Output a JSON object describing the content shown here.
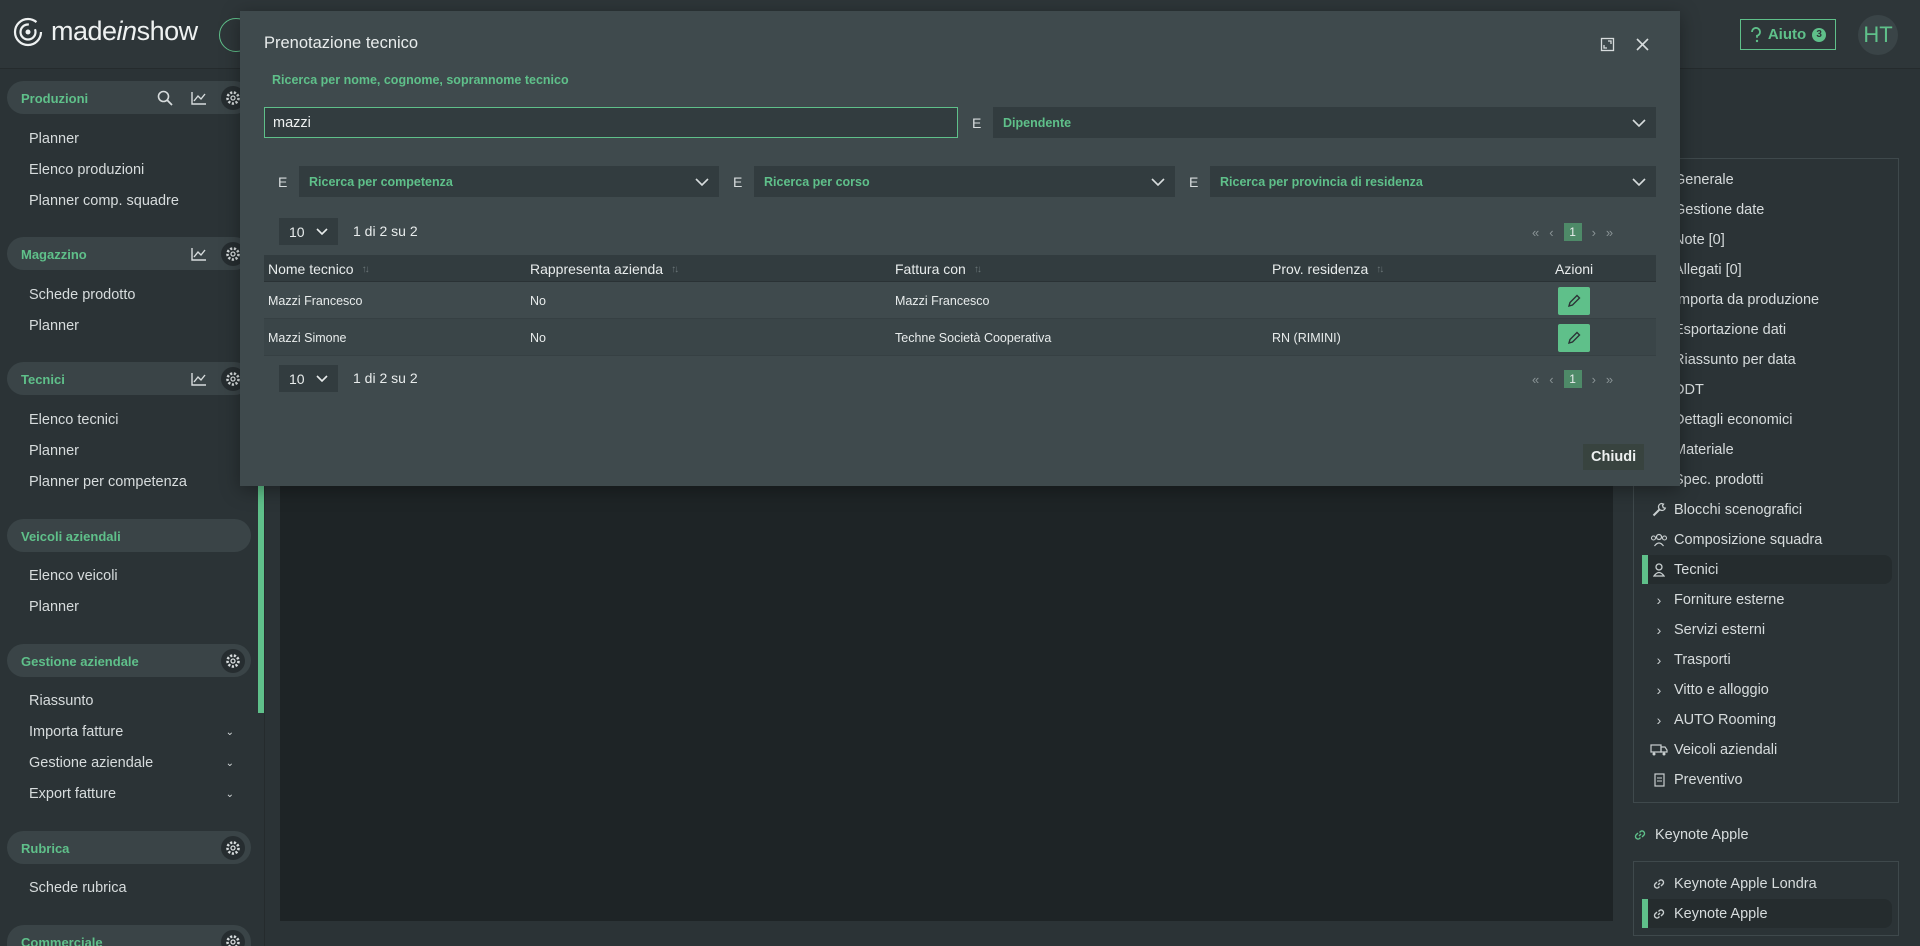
{
  "topbar": {
    "logo_text": "madeinshow",
    "help_label": "Aiuto",
    "help_badge": "3",
    "avatar_initials": "HT"
  },
  "sidebar": {
    "sections": [
      {
        "title": "Produzioni",
        "items": [
          "Planner",
          "Elenco produzioni",
          "Planner comp. squadre"
        ]
      },
      {
        "title": "Magazzino",
        "items": [
          "Schede prodotto",
          "Planner"
        ]
      },
      {
        "title": "Tecnici",
        "items": [
          "Elenco tecnici",
          "Planner",
          "Planner per competenza"
        ]
      },
      {
        "title": "Veicoli aziendali",
        "items": [
          "Elenco veicoli",
          "Planner"
        ]
      },
      {
        "title": "Gestione aziendale",
        "items": [
          "Riassunto",
          "Importa fatture",
          "Gestione aziendale",
          "Export fatture"
        ]
      },
      {
        "title": "Rubrica",
        "items": [
          "Schede rubrica"
        ]
      },
      {
        "title": "Commerciale",
        "items": []
      }
    ]
  },
  "right_menu": {
    "items": [
      "Generale",
      "Gestione date",
      "Note [0]",
      "Allegati [0]",
      "Importa da produzione",
      "Esportazione dati",
      "Riassunto per data",
      "DDT",
      "Dettagli economici",
      "Materiale",
      "Spec. prodotti",
      "Blocchi scenografici",
      "Composizione squadra",
      "Tecnici",
      "Forniture esterne",
      "Servizi esterni",
      "Trasporti",
      "Vitto e alloggio",
      "AUTO Rooming",
      "Veicoli aziendali",
      "Preventivo"
    ],
    "link_title": "Keynote Apple",
    "links": [
      "Keynote Apple Londra",
      "Keynote Apple"
    ]
  },
  "modal": {
    "title": "Prenotazione tecnico",
    "search_label": "Ricerca per nome, cognome, soprannome tecnico",
    "search_value": "mazzi",
    "conjunction": "E",
    "filter_type": "Dipendente",
    "filter_competenza": "Ricerca per competenza",
    "filter_corso": "Ricerca per corso",
    "filter_provincia": "Ricerca per provincia di residenza",
    "page_size": "10",
    "page_info": "1 di 2 su 2",
    "current_page": "1",
    "columns": [
      "Nome tecnico",
      "Rappresenta azienda",
      "Fattura con",
      "Prov. residenza",
      "Azioni"
    ],
    "rows": [
      {
        "nome": "Mazzi Francesco",
        "rappresenta": "No",
        "fattura": "Mazzi Francesco",
        "prov": ""
      },
      {
        "nome": "Mazzi Simone",
        "rappresenta": "No",
        "fattura": "Techne Società Cooperativa",
        "prov": "RN (RIMINI)"
      }
    ],
    "close_label": "Chiudi"
  },
  "colors": {
    "accent": "#5fc08a",
    "modal_bg": "#3f4a4d",
    "page_bg": "#2b3336"
  }
}
